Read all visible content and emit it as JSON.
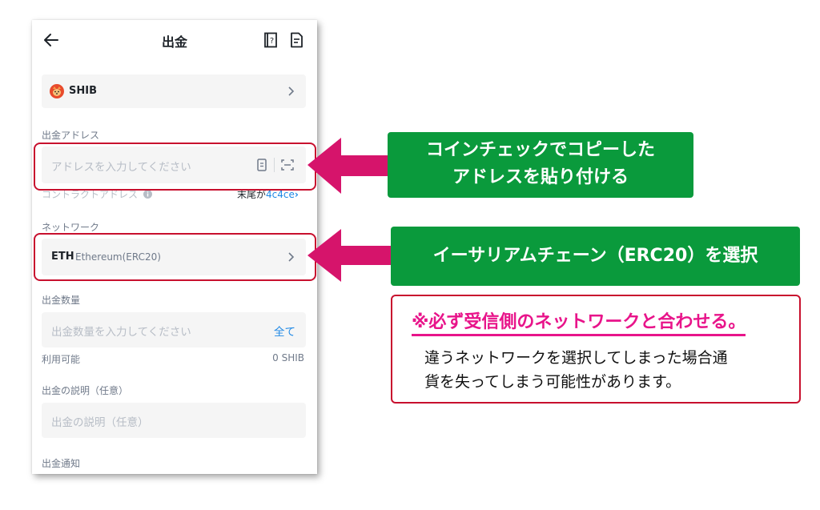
{
  "header": {
    "title": "出金"
  },
  "coin": {
    "symbol": "SHIB"
  },
  "address": {
    "label": "出金アドレス",
    "placeholder": "アドレスを入力してください"
  },
  "contract": {
    "label": "コントラクトアドレス",
    "suffix_prefix": "末尾が",
    "suffix_value": "4c4ce"
  },
  "network": {
    "label": "ネットワーク",
    "code": "ETH",
    "name": "Ethereum(ERC20)"
  },
  "amount": {
    "label": "出金数量",
    "placeholder": "出金数量を入力してください",
    "all_button": "全て",
    "available_label": "利用可能",
    "available_value": "0 SHIB"
  },
  "description": {
    "label": "出金の説明（任意）",
    "placeholder": "出金の説明（任意）"
  },
  "notice": {
    "label": "出金通知"
  },
  "callouts": {
    "address_line1": "コインチェックでコピーした",
    "address_line2": "アドレスを貼り付ける",
    "network": "イーサリアムチェーン（ERC20）を選択"
  },
  "warning": {
    "title": "※必ず受信側のネットワークと合わせる。",
    "body_line1": "違うネットワークを選択してしまった場合通",
    "body_line2": "貨を失ってしまう可能性があります。"
  },
  "colors": {
    "highlight_red": "#c8102e",
    "callout_green": "#0a9a3c",
    "arrow_magenta": "#d6146b",
    "warning_pink": "#e8148a",
    "link_blue": "#1e88e5"
  }
}
